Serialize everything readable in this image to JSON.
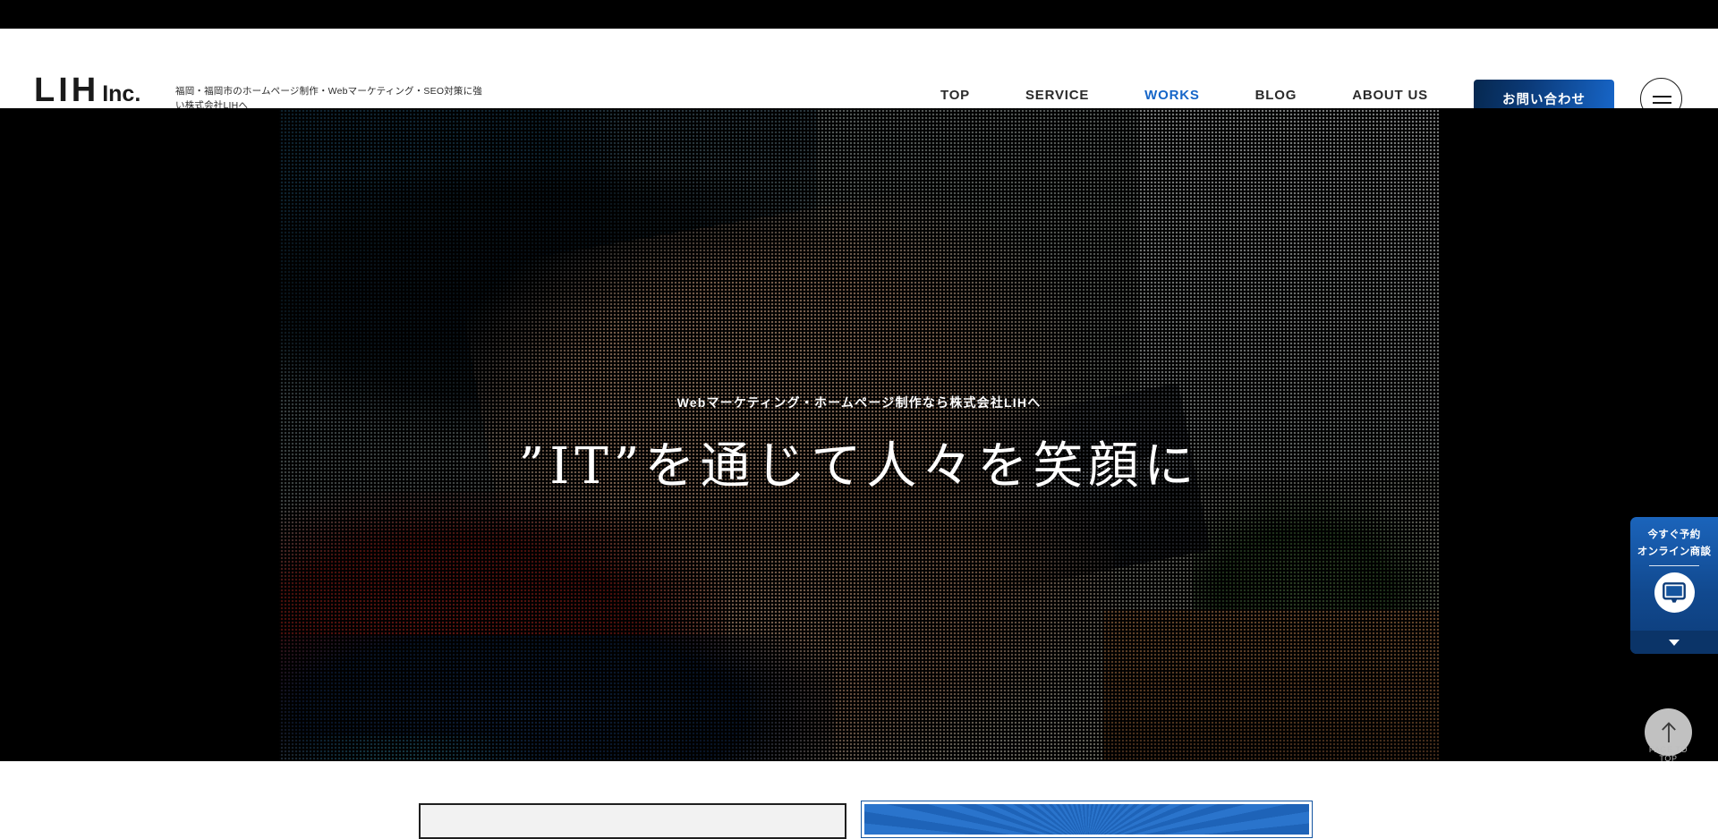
{
  "header": {
    "logo_main": "LIH",
    "logo_sub": "Inc.",
    "tagline": "福岡・福岡市のホームページ制作・Webマーケティング・SEO対策に強い株式会社LIHへ",
    "nav": [
      {
        "label": "TOP",
        "active": false
      },
      {
        "label": "SERVICE",
        "active": false
      },
      {
        "label": "WORKS",
        "active": true
      },
      {
        "label": "BLOG",
        "active": false
      },
      {
        "label": "ABOUT US",
        "active": false
      }
    ],
    "contact_label": "お問い合わせ",
    "menu_icon": "hamburger-icon",
    "accent_color": "#1666c8"
  },
  "hero": {
    "subtitle": "Webマーケティング・ホームページ制作なら株式会社LIHへ",
    "title": "”IT”を通じて人々を笑顔に"
  },
  "widget": {
    "line1": "今すぐ予約",
    "line2": "オンライン商談",
    "icon": "monitor-icon",
    "collapse_icon": "chevron-down-icon",
    "background_color": "#11498f"
  },
  "page_top": {
    "label": "PAGE TO TOP",
    "icon": "arrow-up-icon"
  }
}
